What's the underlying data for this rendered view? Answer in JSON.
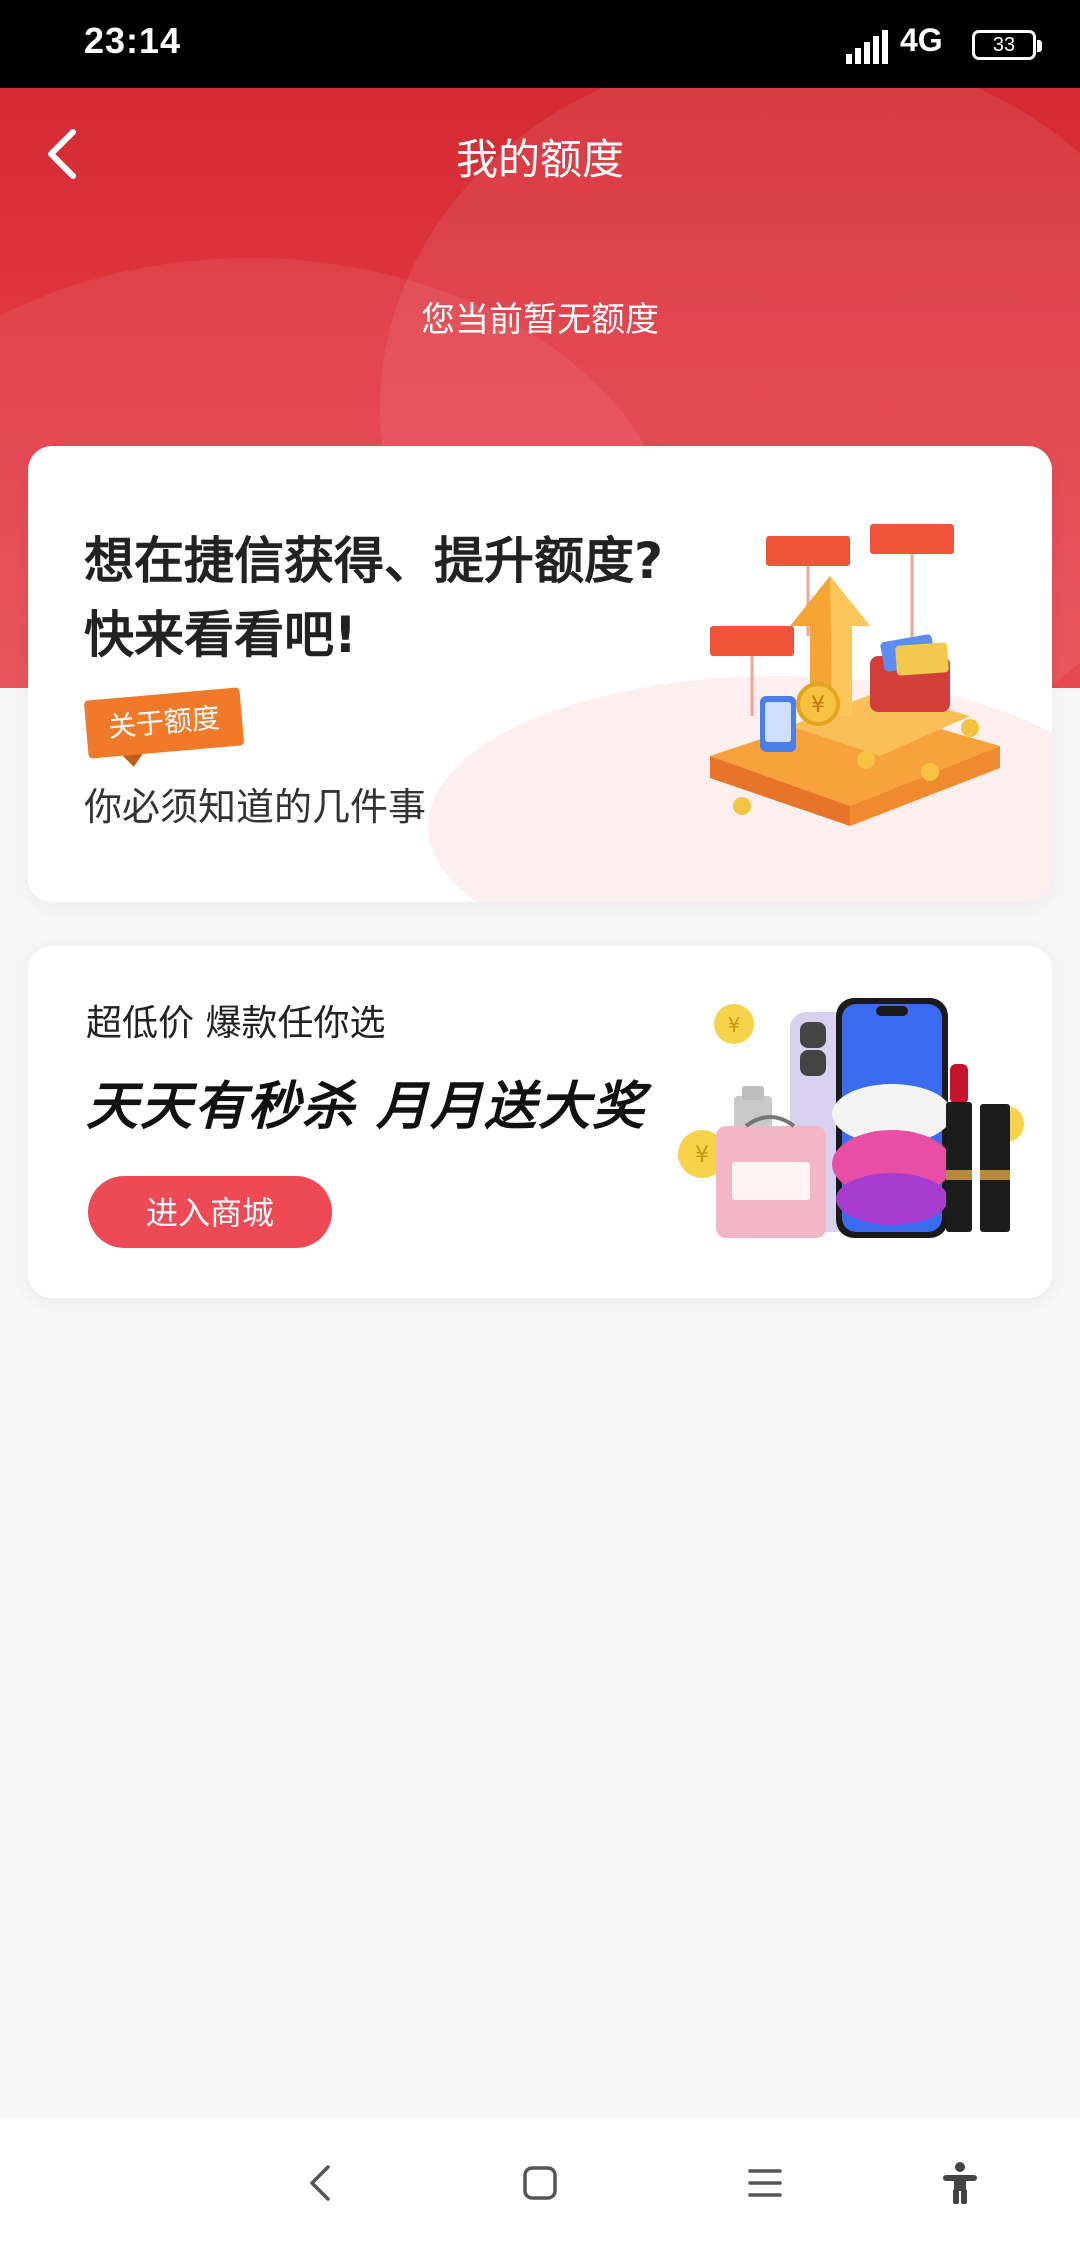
{
  "status_bar": {
    "time": "23:14",
    "network": "4G",
    "battery": "33"
  },
  "header": {
    "title": "我的额度",
    "back_icon": "chevron-left-icon"
  },
  "quota": {
    "status_text": "您当前暂无额度"
  },
  "card_about": {
    "headline_line1": "想在捷信获得、提升额度?",
    "headline_line2": "快来看看吧!",
    "tag": "关于额度",
    "subtitle": "你必须知道的几件事"
  },
  "card_mall": {
    "line1": "超低价 爆款任你选",
    "line2": "天天有秒杀 月月送大奖",
    "button_label": "进入商城"
  },
  "navbar": {
    "items": [
      "back-icon",
      "home-icon",
      "menu-icon",
      "accessibility-icon"
    ]
  },
  "colors": {
    "brand_red": "#d42a33",
    "button_red": "#ee4a55",
    "tag_orange": "#f07a2a"
  }
}
